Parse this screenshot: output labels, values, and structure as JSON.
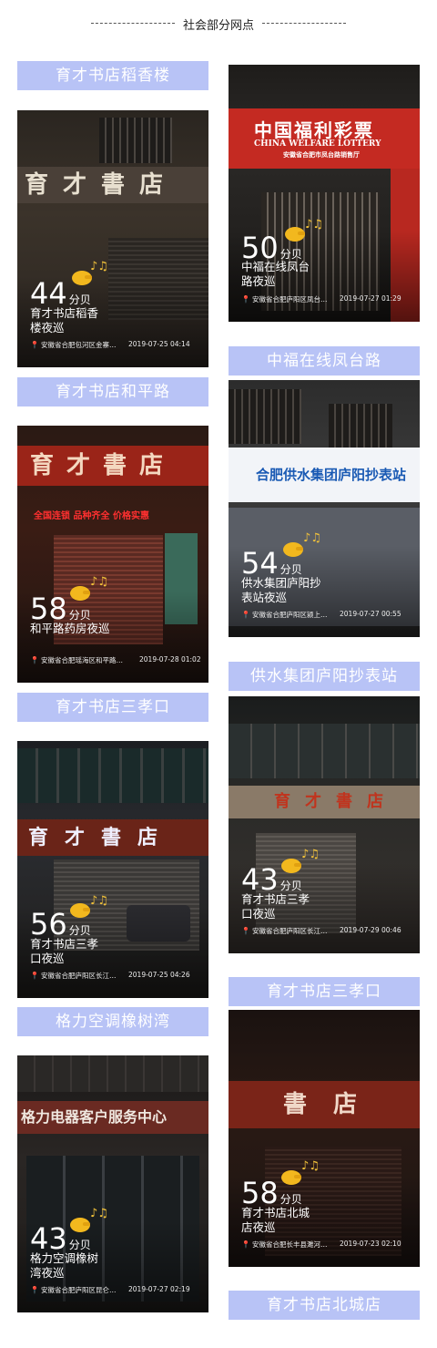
{
  "header": {
    "title": "社会部分网点"
  },
  "labels": [
    "育才书店稻香楼",
    "中福在线凤台路",
    "育才书店和平路",
    "供水集团庐阳抄表站",
    "育才书店三孝口",
    "育才书店三孝口",
    "格力空调橡树湾",
    "育才书店北城店"
  ],
  "unit": "分贝",
  "cards": [
    {
      "db": "44",
      "title": "育才书店稻香楼夜巡",
      "location": "安徽省合肥包河区金寨…",
      "datetime": "2019-07-25 04:14",
      "sign": "育才書店"
    },
    {
      "db": "50",
      "title": "中福在线凤台路夜巡",
      "location": "安徽省合肥庐阳区凤台…",
      "datetime": "2019-07-27 01:29",
      "sign": "中国福利彩票",
      "sign_sub": "CHINA WELFARE LOTTERY",
      "sign_sub2": "安徽省合肥市凤台路销售厅"
    },
    {
      "db": "58",
      "title": "和平路药房夜巡",
      "location": "安徽省合肥瑶海区和平路…",
      "datetime": "2019-07-28 01:02",
      "sign": "育才書店",
      "sign_sub": "全国连锁  品种齐全  价格实惠"
    },
    {
      "db": "54",
      "title": "供水集团庐阳抄表站夜巡",
      "location": "安徽省合肥庐阳区颍上…",
      "datetime": "2019-07-27 00:55",
      "sign": "合肥供水集团庐阳抄表站",
      "sign_sub": "供水"
    },
    {
      "db": "56",
      "title": "育才书店三孝口夜巡",
      "location": "安徽省合肥庐阳区长江…",
      "datetime": "2019-07-25 04:26",
      "sign": "育才書店"
    },
    {
      "db": "43",
      "title": "育才书店三孝口夜巡",
      "location": "安徽省合肥庐阳区长江…",
      "datetime": "2019-07-29 00:46",
      "sign": "育才書店"
    },
    {
      "db": "43",
      "title": "格力空调橡树湾夜巡",
      "location": "安徽省合肥庐阳区昆仑…",
      "datetime": "2019-07-27 02:19",
      "sign": "格力电器客户服务中心"
    },
    {
      "db": "58",
      "title": "育才书店北城店夜巡",
      "location": "安徽省合肥长丰县濉河…",
      "datetime": "2019-07-23 02:10",
      "sign": "書 店"
    }
  ]
}
